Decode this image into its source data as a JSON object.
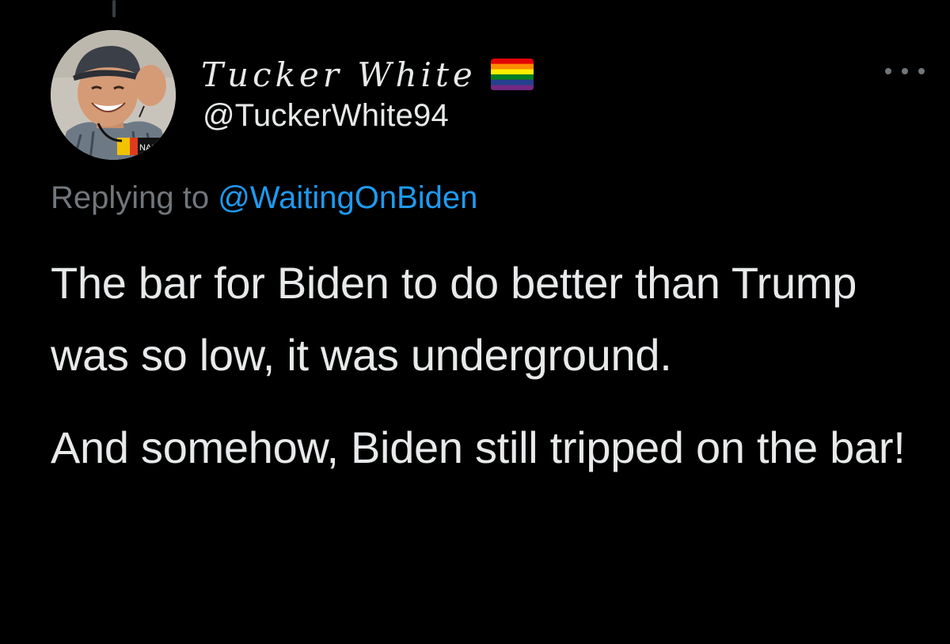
{
  "thread": {
    "connector": "thread-line"
  },
  "author": {
    "display_name": "Tucker White",
    "handle": "@TuckerWhite94",
    "avatar_icon": "avatar-photo",
    "badge_icon": "rainbow-flag-icon"
  },
  "menu": {
    "icon": "more-options-icon"
  },
  "reply": {
    "prefix": "Replying to",
    "mention": "@WaitingOnBiden"
  },
  "tweet": {
    "paragraphs": [
      "The bar for Biden to do better than Trump was so low, it was underground.",
      "And somehow, Biden still tripped on the bar!"
    ]
  },
  "colors": {
    "background": "#000000",
    "text": "#e7e9ea",
    "secondary": "#71767b",
    "link": "#1d9bf0"
  }
}
